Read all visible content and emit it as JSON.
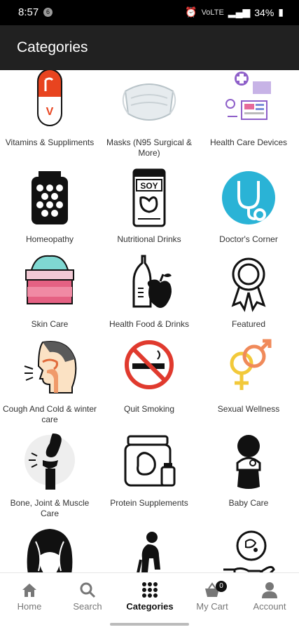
{
  "status_bar": {
    "time": "8:57",
    "notification": "6",
    "network": "VoLTE",
    "battery": "34%"
  },
  "app_bar": {
    "title": "Categories"
  },
  "categories": [
    {
      "label": "Vitamins & Suppliments",
      "icon": "vitamin-capsule-icon"
    },
    {
      "label": "Masks (N95 Surgical & More)",
      "icon": "face-mask-icon"
    },
    {
      "label": "Health Care Devices",
      "icon": "medical-devices-icon"
    },
    {
      "label": "Homeopathy",
      "icon": "homeopathy-pills-jar-icon"
    },
    {
      "label": "Nutritional Drinks",
      "icon": "soy-milk-carton-icon"
    },
    {
      "label": "Doctor's Corner",
      "icon": "stethoscope-icon"
    },
    {
      "label": "Skin Care",
      "icon": "cream-jar-icon"
    },
    {
      "label": "Health Food & Drinks",
      "icon": "bottle-and-apple-icon"
    },
    {
      "label": "Featured",
      "icon": "award-ribbon-icon"
    },
    {
      "label": "Cough And Cold & winter care",
      "icon": "coughing-person-icon"
    },
    {
      "label": "Quit Smoking",
      "icon": "no-smoking-icon"
    },
    {
      "label": "Sexual Wellness",
      "icon": "gender-symbols-icon"
    },
    {
      "label": "Bone, Joint & Muscle Care",
      "icon": "knee-joint-icon"
    },
    {
      "label": "Protein Supplements",
      "icon": "protein-tub-icon"
    },
    {
      "label": "Baby Care",
      "icon": "baby-icon"
    },
    {
      "label": "",
      "icon": "hair-care-icon"
    },
    {
      "label": "",
      "icon": "elderly-person-icon"
    },
    {
      "label": "",
      "icon": "hand-with-microbe-icon"
    }
  ],
  "bottom_nav": {
    "items": [
      {
        "label": "Home",
        "icon": "home-icon"
      },
      {
        "label": "Search",
        "icon": "search-icon"
      },
      {
        "label": "Categories",
        "icon": "grid-icon"
      },
      {
        "label": "My Cart",
        "icon": "cart-icon"
      },
      {
        "label": "Account",
        "icon": "account-icon"
      }
    ],
    "active": "Categories",
    "cart_count": "0"
  }
}
